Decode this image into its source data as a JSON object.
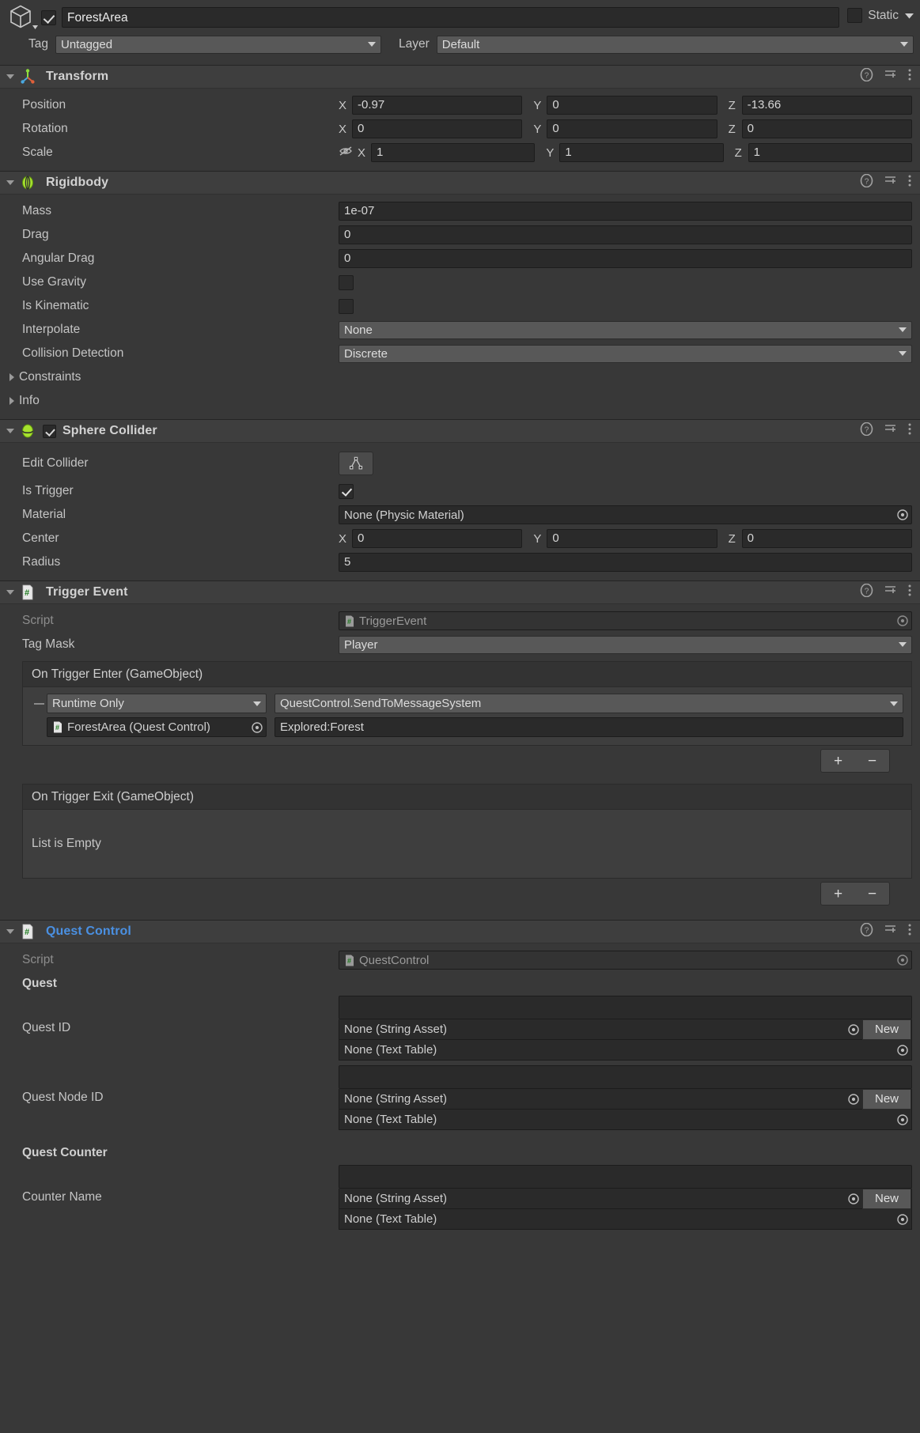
{
  "gameobject": {
    "enabled": true,
    "name": "ForestArea",
    "static_label": "Static",
    "static_checked": false,
    "tag_label": "Tag",
    "tag_value": "Untagged",
    "layer_label": "Layer",
    "layer_value": "Default"
  },
  "transform": {
    "title": "Transform",
    "rows": [
      {
        "label": "Position",
        "x": "-0.97",
        "y": "0",
        "z": "-13.66"
      },
      {
        "label": "Rotation",
        "x": "0",
        "y": "0",
        "z": "0"
      },
      {
        "label": "Scale",
        "x": "1",
        "y": "1",
        "z": "1"
      }
    ],
    "axis": {
      "x": "X",
      "y": "Y",
      "z": "Z"
    }
  },
  "rigidbody": {
    "title": "Rigidbody",
    "mass_label": "Mass",
    "mass_value": "1e-07",
    "drag_label": "Drag",
    "drag_value": "0",
    "angular_drag_label": "Angular Drag",
    "angular_drag_value": "0",
    "use_gravity_label": "Use Gravity",
    "use_gravity_checked": false,
    "is_kinematic_label": "Is Kinematic",
    "is_kinematic_checked": false,
    "interpolate_label": "Interpolate",
    "interpolate_value": "None",
    "collision_detection_label": "Collision Detection",
    "collision_detection_value": "Discrete",
    "constraints_label": "Constraints",
    "info_label": "Info"
  },
  "sphere_collider": {
    "title": "Sphere Collider",
    "enabled": true,
    "edit_collider_label": "Edit Collider",
    "is_trigger_label": "Is Trigger",
    "is_trigger_checked": true,
    "material_label": "Material",
    "material_value": "None (Physic Material)",
    "center_label": "Center",
    "center": {
      "x": "0",
      "y": "0",
      "z": "0"
    },
    "radius_label": "Radius",
    "radius_value": "5"
  },
  "trigger_event": {
    "title": "Trigger Event",
    "script_label": "Script",
    "script_value": "TriggerEvent",
    "tag_mask_label": "Tag Mask",
    "tag_mask_value": "Player",
    "on_enter": {
      "title": "On Trigger Enter (GameObject)",
      "rows": [
        {
          "mode": "Runtime Only",
          "function": "QuestControl.SendToMessageSystem",
          "target": "ForestArea (Quest Control)",
          "argument": "Explored:Forest"
        }
      ]
    },
    "on_exit": {
      "title": "On Trigger Exit (GameObject)",
      "empty_text": "List is Empty"
    },
    "add_label": "+",
    "remove_label": "−"
  },
  "quest_control": {
    "title": "Quest Control",
    "script_label": "Script",
    "script_value": "QuestControl",
    "quest_header": "Quest",
    "quest_id_label": "Quest ID",
    "quest_id_value": "",
    "quest_id_string_asset": "None (String Asset)",
    "quest_id_text_table": "None (Text Table)",
    "quest_node_id_label": "Quest Node ID",
    "quest_node_id_value": "",
    "quest_node_id_string_asset": "None (String Asset)",
    "quest_node_id_text_table": "None (Text Table)",
    "quest_counter_header": "Quest Counter",
    "counter_name_label": "Counter Name",
    "counter_name_value": "",
    "counter_name_string_asset": "None (String Asset)",
    "counter_name_text_table": "None (Text Table)",
    "new_label": "New"
  },
  "colors": {
    "background": "#383838",
    "header_bg": "#3e3e3e",
    "field_bg": "#2a2a2a",
    "dropdown_bg": "#585858",
    "accent_link": "#4a90e2",
    "unity_green": "#a6e22e"
  }
}
